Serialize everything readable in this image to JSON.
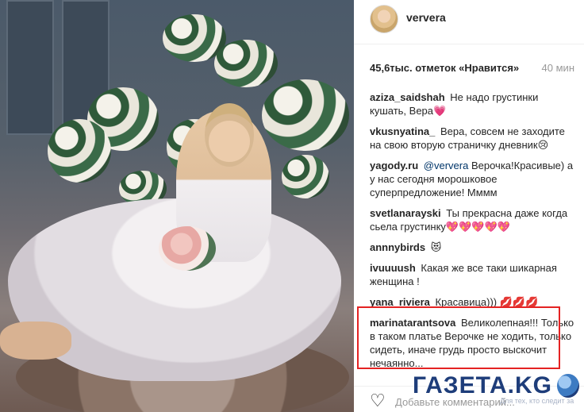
{
  "post": {
    "username": "ververa",
    "likes": "45,6тыс. отметок «Нравится»",
    "time_ago": "40 мин"
  },
  "comments": [
    {
      "user": "aziza_saidshah",
      "text": "Не надо грустинки кушать, Вера💗"
    },
    {
      "user": "vkusnyatina_",
      "text": "Вера, совсем не заходите на свою вторую страничку дневник😢"
    },
    {
      "user": "yagody.ru",
      "mention": "@ververa",
      "text": "Верочка!Красивые) а у нас сегодня морошковое суперпредложение! Мммм"
    },
    {
      "user": "svetlanarayski",
      "text": "Ты прекрасна даже когда сьела грустинку💖💖💖💖💖"
    },
    {
      "user": "annnybirds",
      "text": "😻"
    },
    {
      "user": "ivuuuush",
      "text": "Какая же все таки шикарная женщина !"
    },
    {
      "user": "yana_riviera",
      "text": "Красавица))) 💋💋💋"
    },
    {
      "user": "marinatarantsova",
      "text": "Великолепная!!! Только в таком платье Верочке не ходить, только сидеть, иначе грудь просто выскочит нечаянно..."
    }
  ],
  "footer": {
    "add_comment_placeholder": "Добавьте комментарий...",
    "heart_icon": "♡"
  },
  "watermark": {
    "text": "ГАЗЕТА.KG",
    "subtext": "Для тех, кто следит за"
  },
  "colors": {
    "highlight_border": "#e42323",
    "watermark": "#1e3d7a"
  }
}
